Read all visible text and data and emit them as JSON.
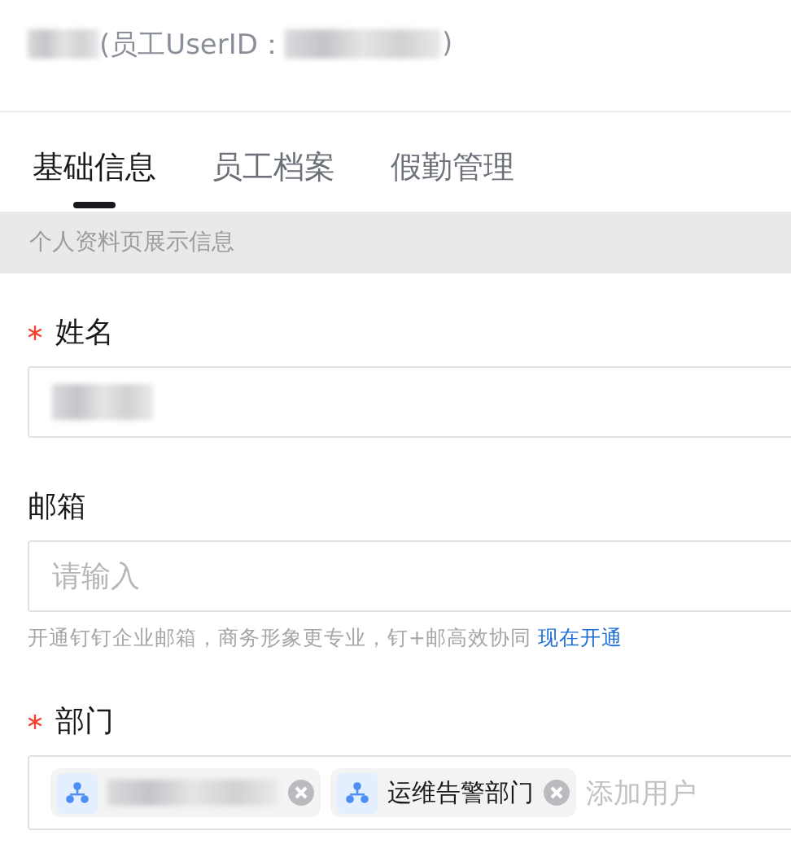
{
  "header": {
    "name_redacted": true,
    "id_label": "(员工UserID：",
    "id_redacted": true,
    "close": ")"
  },
  "tabs": [
    {
      "label": "基础信息",
      "selected": true
    },
    {
      "label": "员工档案",
      "selected": false
    },
    {
      "label": "假勤管理",
      "selected": false
    }
  ],
  "notice": "个人资料页展示信息",
  "fields": [
    {
      "kind": "text",
      "label": "姓名",
      "required": true,
      "value_redacted": true
    },
    {
      "kind": "input",
      "label": "邮箱",
      "required": false,
      "placeholder": "请输入",
      "hint": "开通钉钉企业邮箱，商务形象更专业，钉+邮高效协同",
      "hint_link": "现在开通"
    },
    {
      "kind": "tags",
      "label": "部门",
      "required": true,
      "tags": [
        {
          "redacted": true
        },
        {
          "label": "运维告警部门",
          "redacted": false
        }
      ],
      "placeholder": "添加用户"
    }
  ]
}
